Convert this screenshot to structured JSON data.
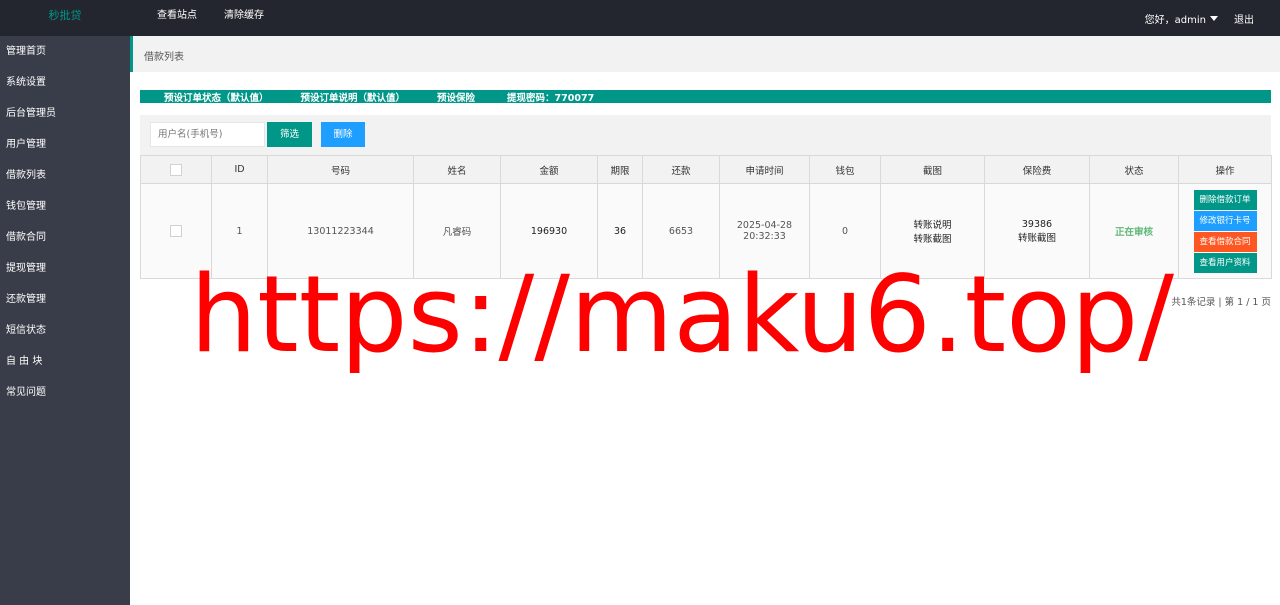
{
  "app": {
    "brand": "秒批贷"
  },
  "topnav": {
    "view_site": "查看站点",
    "clear_cache": "清除缓存"
  },
  "user": {
    "greeting": "您好，admin",
    "logout": "退出"
  },
  "sidebar": {
    "items": [
      {
        "label": "管理首页"
      },
      {
        "label": "系统设置"
      },
      {
        "label": "后台管理员"
      },
      {
        "label": "用户管理"
      },
      {
        "label": "借款列表"
      },
      {
        "label": "钱包管理"
      },
      {
        "label": "借款合同"
      },
      {
        "label": "提现管理"
      },
      {
        "label": "还款管理"
      },
      {
        "label": "短信状态"
      },
      {
        "label": "自 由 块"
      },
      {
        "label": "常见问题"
      }
    ]
  },
  "breadcrumb": "借款列表",
  "notice": {
    "item1": "预设订单状态（默认值）",
    "item2": "预设订单说明（默认值）",
    "item3": "预设保险",
    "item4": "提现密码：770077"
  },
  "filter": {
    "placeholder": "用户名(手机号)",
    "filter_label": "筛选",
    "delete_label": "删除"
  },
  "table": {
    "headers": [
      "ID",
      "号码",
      "姓名",
      "金额",
      "期限",
      "还款",
      "申请时间",
      "钱包",
      "截图",
      "保险费",
      "状态",
      "操作"
    ],
    "rows": [
      {
        "id": "1",
        "phone": "13011223344",
        "name": "凡睿码",
        "amount": "196930",
        "term": "36",
        "repay": "6653",
        "date": "2025-04-28",
        "time": "20:32:33",
        "wallet": "0",
        "shot1": "转账说明",
        "shot2": "转账截图",
        "insurance": "39386",
        "insurance_note": "转账截图",
        "status": "正在审核",
        "op_delete": "删除借款订单",
        "op_edit_card": "修改银行卡号",
        "op_contract": "查看借款合同",
        "op_profile": "查看用户资料"
      }
    ]
  },
  "pager": "共1条记录 | 第 1 / 1 页",
  "watermark": "https://maku6.top/",
  "colors": {
    "accent": "#009688",
    "blue": "#1e9fff",
    "orange": "#ff5722",
    "status_green": "#5fb878",
    "watermark": "#ff0000"
  }
}
